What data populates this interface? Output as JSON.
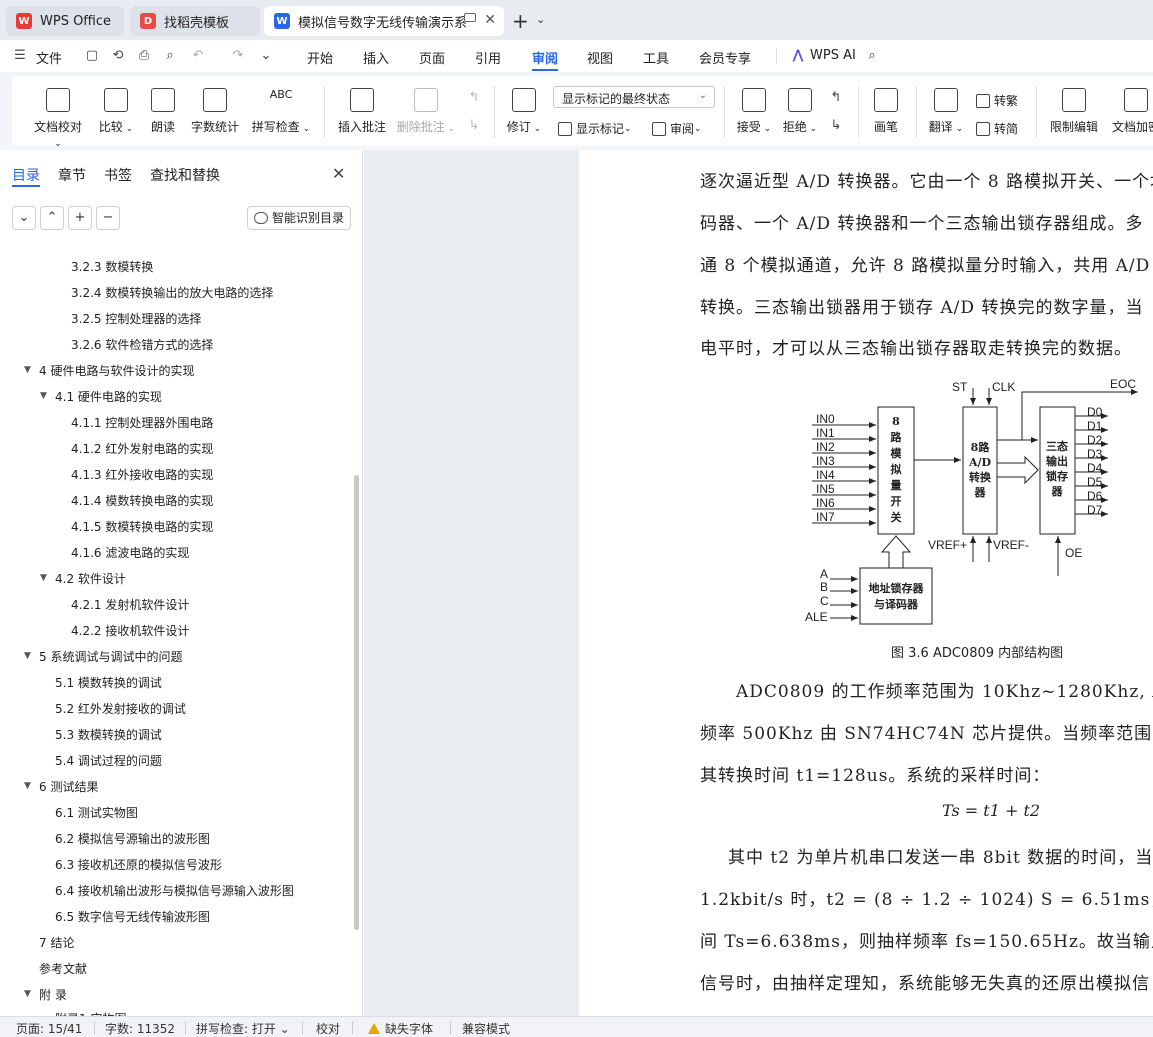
{
  "tabs": {
    "wps": "WPS Office",
    "template": "找稻壳模板",
    "document": "模拟信号数字无线传输演示系"
  },
  "menu": {
    "file": "文件",
    "items": [
      "开始",
      "插入",
      "页面",
      "引用",
      "审阅",
      "视图",
      "工具",
      "会员专享"
    ],
    "wps_ai": "WPS AI"
  },
  "ribbon": {
    "doc_check": "文档校对",
    "compare": "比较",
    "read_aloud": "朗读",
    "word_count": "字数统计",
    "spell_check": "拼写检查",
    "insert_comment": "插入批注",
    "delete_comment": "删除批注",
    "revise": "修订",
    "markup_state": "显示标记的最终状态",
    "show_markup": "显示标记",
    "review": "审阅",
    "accept": "接受",
    "reject": "拒绝",
    "pen": "画笔",
    "translate": "翻译",
    "to_traditional": "转繁",
    "to_simplified": "转简",
    "restrict_edit": "限制编辑",
    "doc_encrypt": "文档加密"
  },
  "nav": {
    "tabs": [
      "目录",
      "章节",
      "书签",
      "查找和替换"
    ],
    "smart_toc": "智能识别目录",
    "items": [
      "3.2.3  数模转换",
      "3.2.4  数模转换输出的放大电路的选择",
      "3.2.5  控制处理器的选择",
      "3.2.6  软件检错方式的选择",
      "4  硬件电路与软件设计的实现",
      "4.1  硬件电路的实现",
      "4.1.1  控制处理器外围电路",
      "4.1.2  红外发射电路的实现",
      "4.1.3  红外接收电路的实现",
      "4.1.4  模数转换电路的实现",
      "4.1.5 数模转换电路的实现",
      "4.1.6 滤波电路的实现",
      "4.2  软件设计",
      "4.2.1  发射机软件设计",
      "4.2.2  接收机软件设计",
      "5  系统调试与调试中的问题",
      "5.1  模数转换的调试",
      "5.2  红外发射接收的调试",
      "5.3  数模转换的调试",
      "5.4  调试过程的问题",
      "6  测试结果",
      "6.1  测试实物图",
      "6.2  模拟信号源输出的波形图",
      "6.3  接收机还原的模拟信号波形",
      "6.4  接收机输出波形与模拟信号源输入波形图",
      "6.5  数字信号无线传输波形图",
      "7  结论",
      "参考文献",
      "附  录",
      "附录1  实物图"
    ]
  },
  "doc": {
    "lines_top": [
      "逐次逼近型 A/D 转换器。它由一个 8 路模拟开关、一个地",
      "码器、一个 A/D  转换器和一个三态输出锁存器组成。多",
      "通 8 个模拟通道，允许 8 路模拟量分时输入，共用 A/D",
      "转换。三态输出锁器用于锁存 A/D  转换完的数字量，当",
      "电平时，才可以从三态输出锁存器取走转换完的数据。"
    ],
    "figure": {
      "inputs": [
        "IN0",
        "IN1",
        "IN2",
        "IN3",
        "IN4",
        "IN5",
        "IN6",
        "IN7"
      ],
      "outputs": [
        "D0",
        "D1",
        "D2",
        "D3",
        "D4",
        "D5",
        "D6",
        "D7"
      ],
      "addr": [
        "A",
        "B",
        "C",
        "ALE"
      ],
      "st": "ST",
      "clk": "CLK",
      "eoc": "EOC",
      "vrefp": "VREF+",
      "vrefm": "VREF-",
      "oe": "OE",
      "switch_block": [
        "8",
        "路",
        "模",
        "拟",
        "量",
        "开",
        "关"
      ],
      "adc_block": [
        "8路",
        "A/D",
        "转换",
        "器"
      ],
      "latch_block": [
        "三态",
        "输出",
        "锁存",
        "器"
      ],
      "addr_block": [
        "地址锁存器",
        "与译码器"
      ]
    },
    "caption": "图 3.6 ADC0809 内部结构图",
    "lines_mid": [
      "ADC0809 的工作频率范围为 10Khz~1280Khz, ADC0",
      "频率 500Khz 由 SN74HC74N 芯片提供。当频率范围为 5",
      "其转换时间 t1=128us。系统的采样时间："
    ],
    "formula": "Ts = t1 + t2",
    "lines_bottom": [
      "其中 t2 为单片机串口发送一串 8bit 数据的时间，当波",
      "1.2kbit/s 时，t2 = (8 ÷ 1.2 ÷ 1024) S = 6.51ms，由公式（3.7）",
      "间 Ts=6.638ms，则抽样频率 fs=150.65Hz。故当输入 10H",
      "信号时，由抽样定理知，系统能够无失真的还原出模拟信"
    ]
  },
  "status": {
    "page": "页面: 15/41",
    "words": "字数: 11352",
    "spell": "拼写检查: 打开",
    "proof": "校对",
    "missing_font": "缺失字体",
    "compat": "兼容模式"
  }
}
